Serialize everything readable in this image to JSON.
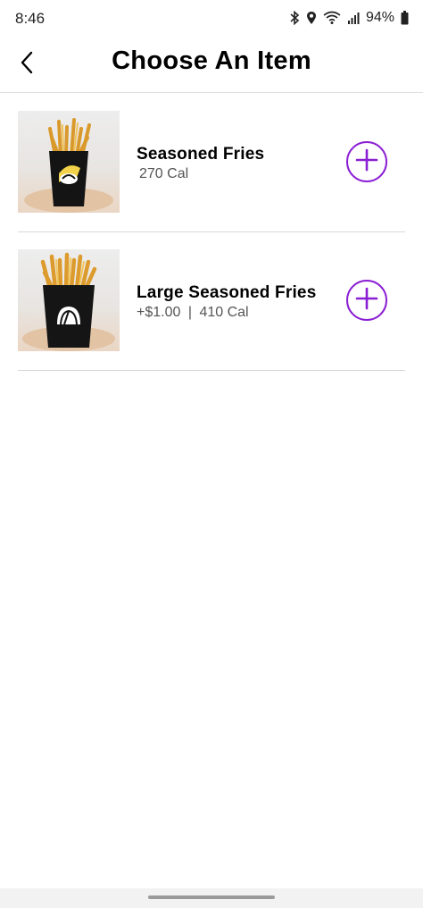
{
  "status_bar": {
    "time": "8:46",
    "battery": "94%",
    "icons": [
      "bluetooth-icon",
      "location-icon",
      "wifi-icon",
      "signal-icon",
      "battery-icon"
    ]
  },
  "header": {
    "title": "Choose An Item",
    "back_icon": "chevron-left-icon"
  },
  "items": [
    {
      "name": "Seasoned Fries",
      "price": "",
      "calories": "270 Cal",
      "add_icon": "plus-circle-icon"
    },
    {
      "name": "Large Seasoned Fries",
      "price": "+$1.00",
      "separator": "|",
      "calories": "410 Cal",
      "add_icon": "plus-circle-icon"
    }
  ],
  "colors": {
    "accent": "#8a1fd3",
    "divider": "#d8d8d8",
    "text_secondary": "#555555"
  }
}
